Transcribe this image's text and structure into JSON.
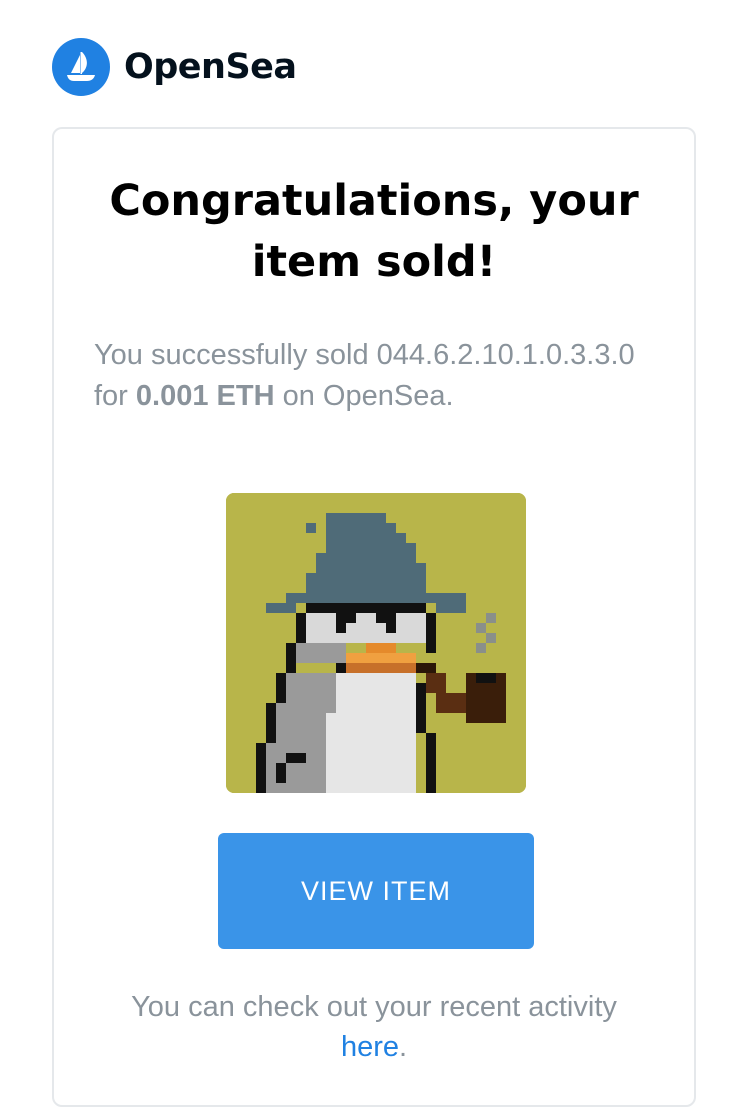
{
  "header": {
    "brand_name": "OpenSea",
    "logo_icon": "opensea-boat-icon",
    "brand_color": "#2081e2"
  },
  "card": {
    "title": "Congratulations, your item sold!",
    "message": {
      "prefix": "You successfully sold",
      "item_name": "044.6.2.10.1.0.3.3.0",
      "for_text": "for",
      "amount": "0.001 ETH",
      "suffix": "on OpenSea."
    },
    "image": {
      "icon": "wizard-penguin-nft-image",
      "background_color": "#b8b54a"
    },
    "button_label": "VIEW ITEM",
    "button_color": "#3a94e8",
    "footer": {
      "text": "You can check out your recent activity",
      "link_text": "here",
      "link_suffix": "."
    }
  }
}
